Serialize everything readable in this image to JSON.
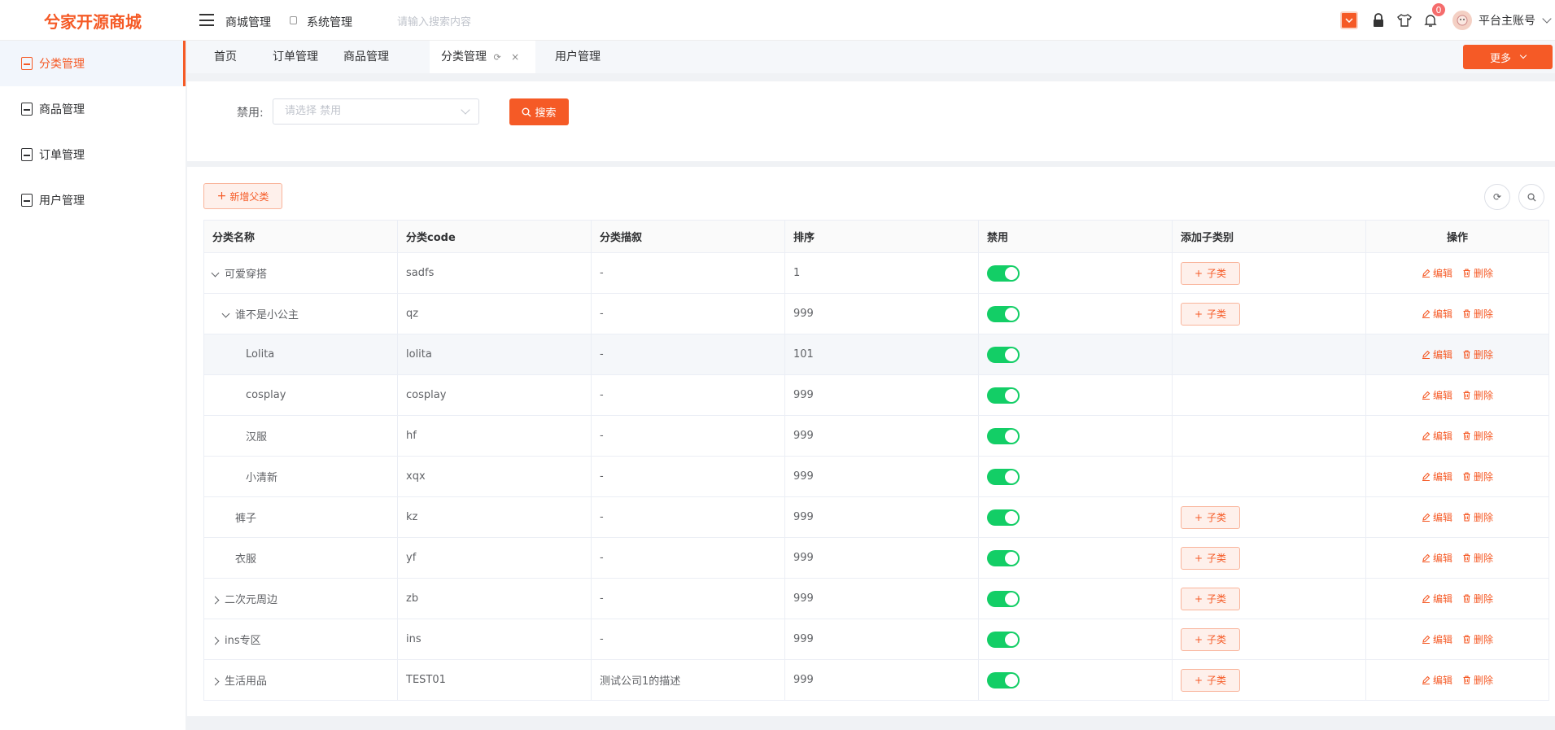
{
  "app": {
    "logo": "兮家开源商城"
  },
  "topbar": {
    "menu1": "商城管理",
    "menu2": "系统管理",
    "search_placeholder": "请输入搜索内容",
    "notif_count": "0",
    "account": "平台主账号"
  },
  "sidebar": {
    "items": [
      {
        "label": "分类管理",
        "active": true
      },
      {
        "label": "商品管理",
        "active": false
      },
      {
        "label": "订单管理",
        "active": false
      },
      {
        "label": "用户管理",
        "active": false
      }
    ]
  },
  "tabs": [
    {
      "label": "首页"
    },
    {
      "label": "订单管理"
    },
    {
      "label": "商品管理"
    },
    {
      "label": "分类管理",
      "active": true
    },
    {
      "label": "用户管理"
    }
  ],
  "more_label": "更多",
  "filter": {
    "label": "禁用:",
    "placeholder": "请选择 禁用",
    "search_label": "搜索"
  },
  "toolbar": {
    "add_parent": "新增父类"
  },
  "table": {
    "headers": [
      "分类名称",
      "分类code",
      "分类描叙",
      "排序",
      "禁用",
      "添加子类别",
      "操作"
    ],
    "add_child_label": "子类",
    "edit_label": "编辑",
    "delete_label": "删除",
    "rows": [
      {
        "name": "可爱穿搭",
        "code": "sadfs",
        "desc": "-",
        "sort": "1",
        "disabled": true,
        "level": 0,
        "expand": "down",
        "has_child_btn": true
      },
      {
        "name": "谁不是小公主",
        "code": "qz",
        "desc": "-",
        "sort": "999",
        "disabled": true,
        "level": 1,
        "expand": "down",
        "has_child_btn": true
      },
      {
        "name": "Lolita",
        "code": "lolita",
        "desc": "-",
        "sort": "101",
        "disabled": true,
        "level": 2,
        "expand": "",
        "has_child_btn": false
      },
      {
        "name": "cosplay",
        "code": "cosplay",
        "desc": "-",
        "sort": "999",
        "disabled": true,
        "level": 2,
        "expand": "",
        "has_child_btn": false
      },
      {
        "name": "汉服",
        "code": "hf",
        "desc": "-",
        "sort": "999",
        "disabled": true,
        "level": 2,
        "expand": "",
        "has_child_btn": false
      },
      {
        "name": "小清新",
        "code": "xqx",
        "desc": "-",
        "sort": "999",
        "disabled": true,
        "level": 2,
        "expand": "",
        "has_child_btn": false
      },
      {
        "name": "裤子",
        "code": "kz",
        "desc": "-",
        "sort": "999",
        "disabled": true,
        "level": 1,
        "expand": "",
        "has_child_btn": true
      },
      {
        "name": "衣服",
        "code": "yf",
        "desc": "-",
        "sort": "999",
        "disabled": true,
        "level": 1,
        "expand": "",
        "has_child_btn": true
      },
      {
        "name": "二次元周边",
        "code": "zb",
        "desc": "-",
        "sort": "999",
        "disabled": true,
        "level": 0,
        "expand": "right",
        "has_child_btn": true
      },
      {
        "name": "ins专区",
        "code": "ins",
        "desc": "-",
        "sort": "999",
        "disabled": true,
        "level": 0,
        "expand": "right",
        "has_child_btn": true
      },
      {
        "name": "生活用品",
        "code": "TEST01",
        "desc": "测试公司1的描述",
        "sort": "999",
        "disabled": true,
        "level": 0,
        "expand": "right",
        "has_child_btn": true
      }
    ]
  },
  "colors": {
    "accent": "#f55a26",
    "switch_on": "#13ce66"
  }
}
